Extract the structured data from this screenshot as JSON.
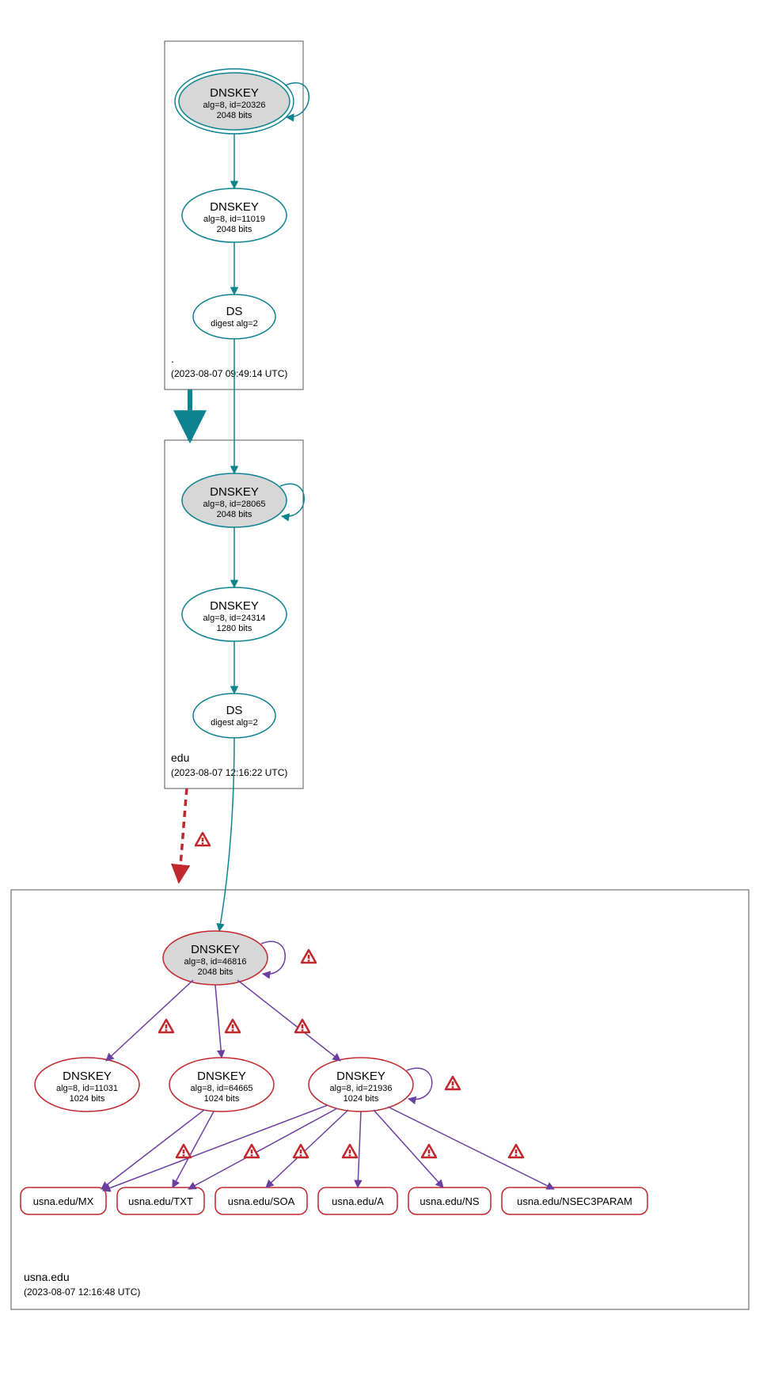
{
  "colors": {
    "teal": "#0e8390",
    "red": "#c1272d",
    "purple": "#6b3fa0",
    "gray_fill": "#d7d7d7",
    "box_stroke": "#555555"
  },
  "zones": {
    "root": {
      "label": ".",
      "timestamp": "(2023-08-07 09:49:14 UTC)"
    },
    "edu": {
      "label": "edu",
      "timestamp": "(2023-08-07 12:16:22 UTC)"
    },
    "usna": {
      "label": "usna.edu",
      "timestamp": "(2023-08-07 12:16:48 UTC)"
    }
  },
  "nodes": {
    "root_ksk": {
      "title": "DNSKEY",
      "line1": "alg=8, id=20326",
      "line2": "2048 bits"
    },
    "root_zsk": {
      "title": "DNSKEY",
      "line1": "alg=8, id=11019",
      "line2": "2048 bits"
    },
    "root_ds": {
      "title": "DS",
      "line1": "digest alg=2",
      "line2": ""
    },
    "edu_ksk": {
      "title": "DNSKEY",
      "line1": "alg=8, id=28065",
      "line2": "2048 bits"
    },
    "edu_zsk": {
      "title": "DNSKEY",
      "line1": "alg=8, id=24314",
      "line2": "1280 bits"
    },
    "edu_ds": {
      "title": "DS",
      "line1": "digest alg=2",
      "line2": ""
    },
    "usna_ksk": {
      "title": "DNSKEY",
      "line1": "alg=8, id=46816",
      "line2": "2048 bits"
    },
    "usna_d1": {
      "title": "DNSKEY",
      "line1": "alg=8, id=11031",
      "line2": "1024 bits"
    },
    "usna_d2": {
      "title": "DNSKEY",
      "line1": "alg=8, id=64665",
      "line2": "1024 bits"
    },
    "usna_d3": {
      "title": "DNSKEY",
      "line1": "alg=8, id=21936",
      "line2": "1024 bits"
    }
  },
  "rrsets": {
    "mx": "usna.edu/MX",
    "txt": "usna.edu/TXT",
    "soa": "usna.edu/SOA",
    "a": "usna.edu/A",
    "ns": "usna.edu/NS",
    "nsec": "usna.edu/NSEC3PARAM"
  }
}
